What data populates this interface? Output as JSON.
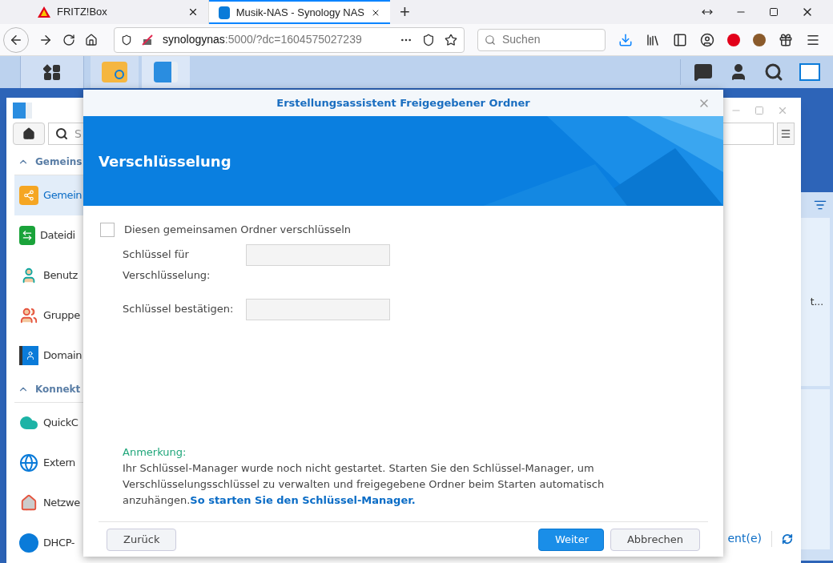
{
  "browser": {
    "tabs": [
      {
        "title": "FRITZ!Box",
        "kind": "fritz",
        "selected": false
      },
      {
        "title": "Musik-NAS - Synology NAS",
        "kind": "dsm",
        "selected": true
      }
    ],
    "new_tab": "+",
    "url": {
      "host": "synologynas",
      "rest": ":5000/?dc=1604575027239"
    },
    "search": {
      "placeholder": "Suchen"
    }
  },
  "control_panel": {
    "search": {
      "placeholder": "S"
    },
    "sidebar": [
      {
        "kind": "header",
        "label": "Gemeins",
        "expanded": true
      },
      {
        "kind": "item",
        "label": "Gemein",
        "selected": true
      },
      {
        "kind": "item",
        "label": "Dateidi",
        "selected": false
      },
      {
        "kind": "item",
        "label": "Benutz",
        "selected": false
      },
      {
        "kind": "item",
        "label": "Gruppe",
        "selected": false
      },
      {
        "kind": "item",
        "label": "Domain",
        "selected": false
      },
      {
        "kind": "header",
        "label": "Konnekt",
        "expanded": true
      },
      {
        "kind": "item",
        "label": "QuickC",
        "selected": false
      },
      {
        "kind": "item",
        "label": "Extern",
        "selected": false
      },
      {
        "kind": "item",
        "label": "Netzwe",
        "selected": false
      },
      {
        "kind": "item",
        "label": "DHCP-",
        "selected": false
      }
    ],
    "footer_link": "ent(e)"
  },
  "background_widget": {
    "text": "t..."
  },
  "dialog": {
    "title": "Erstellungsassistent Freigegebener Ordner",
    "heading": "Verschlüsselung",
    "encrypt": {
      "label": "Diesen gemeinsamen Ordner verschlüsseln",
      "checked": false
    },
    "fields": [
      {
        "label": "Schlüssel für Verschlüsselung:"
      },
      {
        "label": "Schlüssel bestätigen:"
      }
    ],
    "note": {
      "title": "Anmerkung:",
      "text": "Ihr Schlüssel-Manager wurde noch nicht gestartet. Starten Sie den Schlüssel-Manager, um Verschlüsselungsschlüssel zu verwalten und freigegebene Ordner beim Starten automatisch anzuhängen.",
      "link": "So starten Sie den Schlüssel-Manager."
    },
    "buttons": [
      {
        "label": "Zurück",
        "kind": "secondary"
      },
      {
        "label": "Weiter",
        "kind": "primary"
      },
      {
        "label": "Abbrechen",
        "kind": "secondary"
      }
    ]
  }
}
